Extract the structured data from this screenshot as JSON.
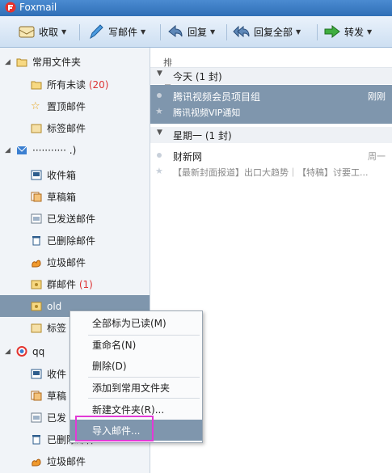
{
  "app": {
    "title": "Foxmail"
  },
  "toolbar": {
    "receive": "收取",
    "compose": "写邮件",
    "reply": "回复",
    "reply_all": "回复全部",
    "forward": "转发"
  },
  "sidebar": {
    "favorites": {
      "label": "常用文件夹",
      "items": [
        {
          "label": "所有未读",
          "count": "(20)",
          "icon": "folder-icon"
        },
        {
          "label": "置顶邮件",
          "icon": "star-icon"
        },
        {
          "label": "标签邮件",
          "icon": "tag-folder-icon"
        }
      ]
    },
    "account1": {
      "label": "···········  .)",
      "items": [
        {
          "label": "收件箱",
          "icon": "inbox-icon"
        },
        {
          "label": "草稿箱",
          "icon": "drafts-icon"
        },
        {
          "label": "已发送邮件",
          "icon": "sent-icon"
        },
        {
          "label": "已删除邮件",
          "icon": "trash-icon"
        },
        {
          "label": "垃圾邮件",
          "icon": "spam-icon"
        },
        {
          "label": "群邮件",
          "count": "(1)",
          "icon": "group-mail-icon"
        },
        {
          "label": "old",
          "icon": "folder-icon"
        },
        {
          "label": "标签",
          "icon": "tag-folder-icon"
        }
      ]
    },
    "account2": {
      "label": "qq",
      "items": [
        {
          "label": "收件",
          "icon": "inbox-icon"
        },
        {
          "label": "草稿",
          "icon": "drafts-icon"
        },
        {
          "label": "已发",
          "icon": "sent-icon"
        },
        {
          "label": "已删除邮件",
          "icon": "trash-icon"
        },
        {
          "label": "垃圾邮件",
          "icon": "spam-icon"
        }
      ]
    }
  },
  "mail_list": {
    "sort_label": "排序:日期",
    "groups": [
      {
        "label": "今天 (1 封)",
        "mails": [
          {
            "from": "腾讯视频会员项目组",
            "subject": "腾讯视频VIP通知",
            "time": "刚刚"
          }
        ]
      },
      {
        "label": "星期一 (1 封)",
        "mails": [
          {
            "from": "财新网",
            "subject": "【最新封面报道】出口大趋势｜【特稿】讨要工...",
            "time": "周一"
          }
        ]
      }
    ]
  },
  "context_menu": {
    "items": [
      "全部标为已读(M)",
      "重命名(N)",
      "删除(D)",
      "添加到常用文件夹",
      "新建文件夹(R)...",
      "导入邮件..."
    ]
  },
  "colors": {
    "selection": "#7f96ad",
    "count_red": "#dd3333",
    "annotation_box": "#e23ad6"
  }
}
